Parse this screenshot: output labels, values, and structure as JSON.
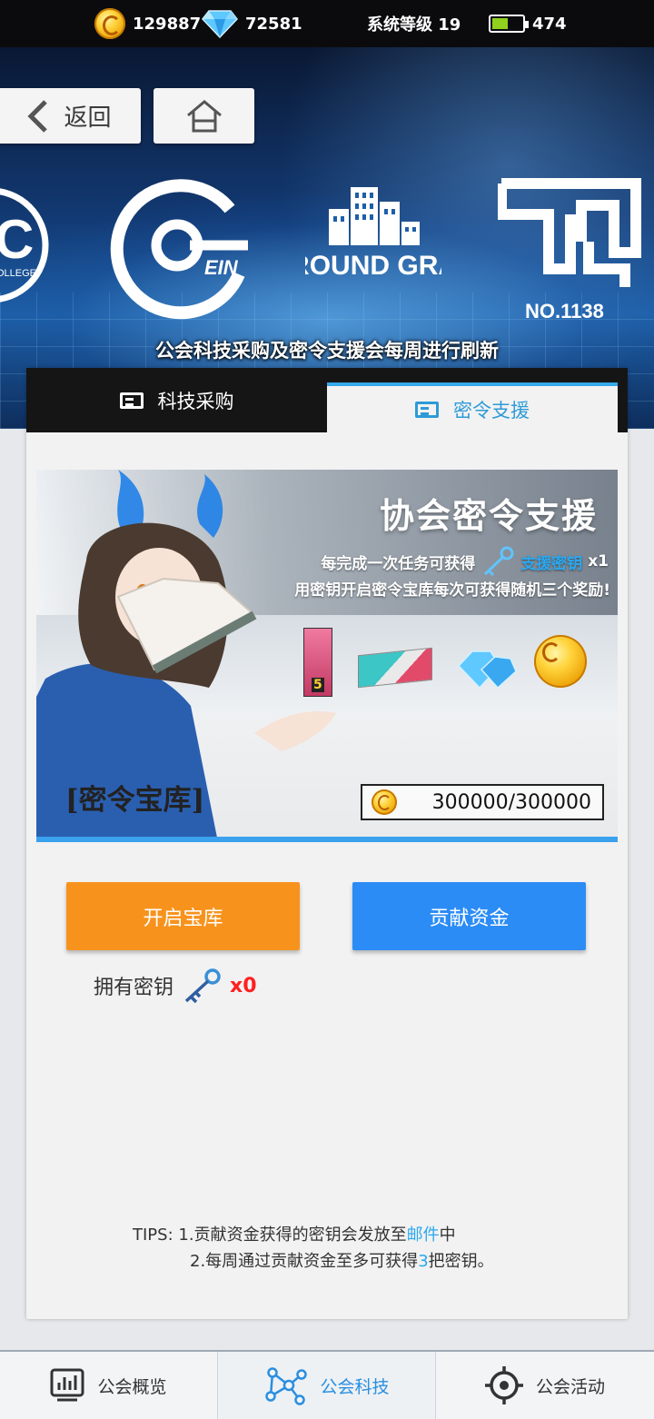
{
  "status_bar": {
    "coins": "129887",
    "diamonds": "72581",
    "system_level": "系统等级 19",
    "energy": "474"
  },
  "header": {
    "back_label": "返回",
    "logos": [
      "EIN",
      "GROUND GRAY.",
      "NO.1138"
    ],
    "logo_partial_text": "OLLEGE",
    "notice": "公会科技采购及密令支援会每周进行刷新"
  },
  "tabs": [
    {
      "label": "科技采购",
      "active": false
    },
    {
      "label": "密令支援",
      "active": true
    }
  ],
  "promo": {
    "title": "协会密令支援",
    "line1_text": "每完成一次任务可获得",
    "line1_highlight": "支援密钥",
    "line1_suffix": "x1",
    "line2": "用密钥开启密令宝库每次可获得随机三个奖励!",
    "reward_badge": "5",
    "vault_label": "[密令宝库]",
    "fund_progress": "300000/300000"
  },
  "actions": {
    "open_label": "开启宝库",
    "contribute_label": "贡献资金",
    "keys_label": "拥有密钥",
    "keys_count": "x0"
  },
  "tips": {
    "prefix": "TIPS:",
    "line1_pre": "1.贡献资金获得的密钥会发放至",
    "line1_link": "邮件",
    "line1_post": "中",
    "line2_pre": "2.每周通过贡献资金至多可获得",
    "line2_num": "3",
    "line2_post": "把密钥。"
  },
  "bottom_nav": [
    {
      "label": "公会概览",
      "icon": "chart-icon"
    },
    {
      "label": "公会科技",
      "icon": "network-icon",
      "active": true
    },
    {
      "label": "公会活动",
      "icon": "target-icon"
    }
  ],
  "colors": {
    "accent_blue": "#2aa8f0",
    "open_button": "#f7931d",
    "contribute_button": "#2c8cf5",
    "keys_count": "#ff2020"
  }
}
